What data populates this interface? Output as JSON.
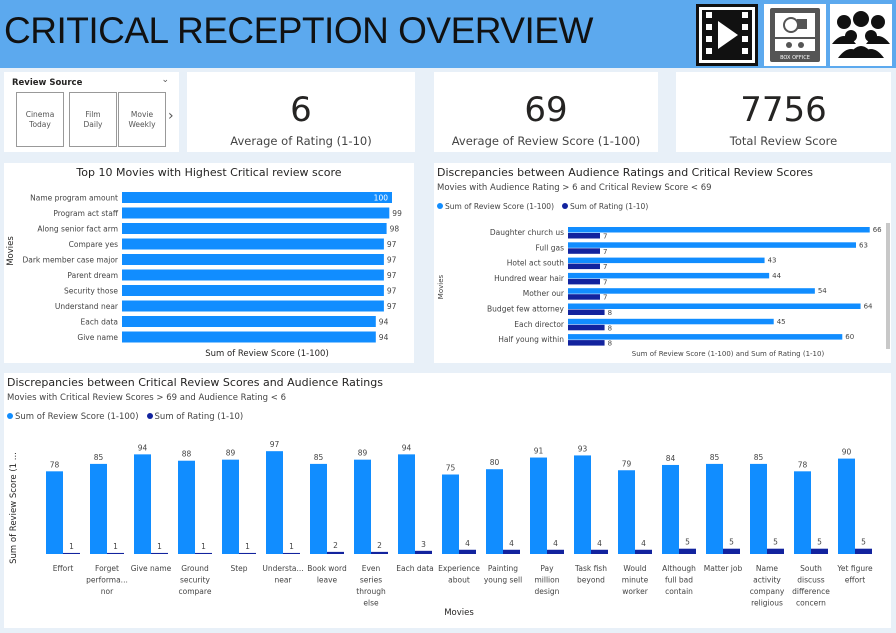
{
  "header": {
    "title": "CRITICAL RECEPTION OVERVIEW",
    "icon_box_office_label": "BOX OFFICE"
  },
  "slicer": {
    "title": "Review Source",
    "options": [
      {
        "label": "Cinema Today"
      },
      {
        "label": "Film Daily"
      },
      {
        "label": "Movie Weekly"
      }
    ]
  },
  "kpis": [
    {
      "value": "6",
      "label": "Average of Rating (1-10)"
    },
    {
      "value": "69",
      "label": "Average of Review Score (1-100)"
    },
    {
      "value": "7756",
      "label": "Total Review Score"
    }
  ],
  "colors": {
    "score": "#118dff",
    "rating": "#12239e",
    "accent": "#5ca9ee"
  },
  "chart_data": [
    {
      "type": "bar",
      "orientation": "horizontal",
      "title": "Top 10 Movies with Highest Critical review score",
      "xlabel": "Sum of Review Score (1-100)",
      "ylabel": "Movies",
      "categories": [
        "Name program amount",
        "Program act staff",
        "Along senior fact arm",
        "Compare yes",
        "Dark member case major",
        "Parent dream",
        "Security those",
        "Understand near",
        "Each data",
        "Give name"
      ],
      "values": [
        100,
        99,
        98,
        97,
        97,
        97,
        97,
        97,
        94,
        94
      ]
    },
    {
      "type": "bar",
      "orientation": "horizontal",
      "title": "Discrepancies between Audience Ratings and Critical Review Scores",
      "subtitle": "Movies with Audience Rating > 6 and Critical Review Score < 69",
      "xlabel": "Sum of Review Score (1-100) and Sum of Rating (1-10)",
      "ylabel": "Movies",
      "categories": [
        "Daughter church us",
        "Full gas",
        "Hotel act south",
        "Hundred wear hair",
        "Mother our",
        "Budget few attorney",
        "Each director",
        "Half young within"
      ],
      "series": [
        {
          "name": "Sum of Review Score (1-100)",
          "values": [
            66,
            63,
            43,
            44,
            54,
            64,
            45,
            60
          ]
        },
        {
          "name": "Sum of Rating (1-10)",
          "values": [
            7,
            7,
            7,
            7,
            7,
            8,
            8,
            8
          ]
        }
      ]
    },
    {
      "type": "bar",
      "orientation": "vertical",
      "title": "Discrepancies between Critical Review Scores and Audience Ratings",
      "subtitle": "Movies with  Critical Review Scores > 69 and Audience Rating < 6",
      "xlabel": "Movies",
      "ylabel": "Sum of Review Score (1 ...",
      "categories": [
        "Effort",
        "Forget performa... nor",
        "Give name",
        "Ground security compare",
        "Step",
        "Understa... near",
        "Book word leave",
        "Even series through else",
        "Each data",
        "Experience about",
        "Painting young sell",
        "Pay million design",
        "Task fish beyond",
        "Would minute worker",
        "Although full bad contain",
        "Matter job",
        "Name activity company religious",
        "South discuss difference concern",
        "Yet figure effort"
      ],
      "series": [
        {
          "name": "Sum of Review Score (1-100)",
          "values": [
            78,
            85,
            94,
            88,
            89,
            97,
            85,
            89,
            94,
            75,
            80,
            91,
            93,
            79,
            84,
            85,
            85,
            78,
            90
          ]
        },
        {
          "name": "Sum of Rating (1-10)",
          "values": [
            1,
            1,
            1,
            1,
            1,
            1,
            2,
            2,
            3,
            4,
            4,
            4,
            4,
            4,
            5,
            5,
            5,
            5,
            5
          ]
        }
      ]
    }
  ]
}
